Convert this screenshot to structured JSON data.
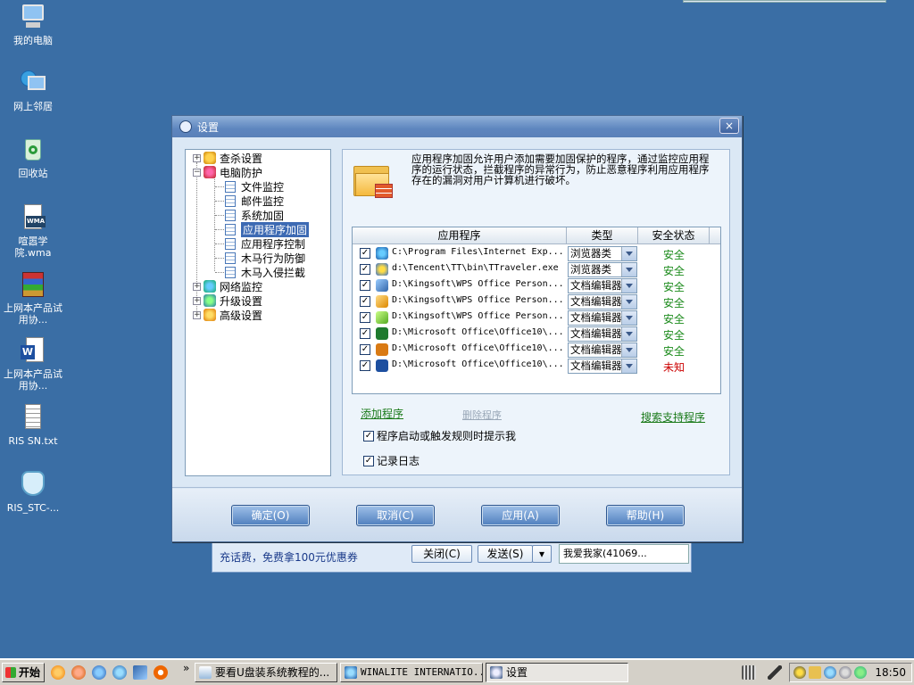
{
  "desktop": {
    "icons": [
      {
        "label": "我的电脑"
      },
      {
        "label": "网上邻居"
      },
      {
        "label": "回收站"
      },
      {
        "label": "喧嚣学院.wma"
      },
      {
        "label": "上网本产品试用协..."
      },
      {
        "label": "上网本产品试用协..."
      },
      {
        "label": "RIS SN.txt"
      },
      {
        "label": "RIS_STC-..."
      }
    ]
  },
  "dialog": {
    "title": "设置",
    "close": "×",
    "tree": [
      {
        "label": "查杀设置",
        "toggle": "+"
      },
      {
        "label": "电脑防护",
        "toggle": "−"
      },
      {
        "label": "文件监控"
      },
      {
        "label": "邮件监控"
      },
      {
        "label": "系统加固"
      },
      {
        "label": "应用程序加固"
      },
      {
        "label": "应用程序控制"
      },
      {
        "label": "木马行为防御"
      },
      {
        "label": "木马入侵拦截"
      },
      {
        "label": "网络监控",
        "toggle": "+"
      },
      {
        "label": "升级设置",
        "toggle": "+"
      },
      {
        "label": "高级设置",
        "toggle": "+"
      }
    ],
    "description": "应用程序加固允许用户添加需要加固保护的程序，通过监控应用程序的运行状态，拦截程序的异常行为，防止恶意程序利用应用程序存在的漏洞对用户计算机进行破坏。",
    "table": {
      "headers": [
        "应用程序",
        "类型",
        "安全状态"
      ],
      "rows": [
        {
          "checked": "✓",
          "path": "C:\\Program Files\\Internet Exp...",
          "type": "浏览器类",
          "status": "安全"
        },
        {
          "checked": "✓",
          "path": "d:\\Tencent\\TT\\bin\\TTraveler.exe",
          "type": "浏览器类",
          "status": "安全"
        },
        {
          "checked": "✓",
          "path": "D:\\Kingsoft\\WPS Office Person...",
          "type": "文档编辑器",
          "status": "安全"
        },
        {
          "checked": "✓",
          "path": "D:\\Kingsoft\\WPS Office Person...",
          "type": "文档编辑器",
          "status": "安全"
        },
        {
          "checked": "✓",
          "path": "D:\\Kingsoft\\WPS Office Person...",
          "type": "文档编辑器",
          "status": "安全"
        },
        {
          "checked": "✓",
          "path": "D:\\Microsoft Office\\Office10\\...",
          "type": "文档编辑器",
          "status": "安全"
        },
        {
          "checked": "✓",
          "path": "D:\\Microsoft Office\\Office10\\...",
          "type": "文档编辑器",
          "status": "安全"
        },
        {
          "checked": "✓",
          "path": "D:\\Microsoft Office\\Office10\\...",
          "type": "文档编辑器",
          "status": "未知"
        }
      ]
    },
    "links": {
      "add": "添加程序",
      "delete": "删除程序",
      "search": "搜索支持程序"
    },
    "options": [
      {
        "checked": "✓",
        "label": "程序启动或触发规则时提示我"
      },
      {
        "checked": "✓",
        "label": "记录日志"
      }
    ],
    "buttons": {
      "ok": "确定(O)",
      "cancel": "取消(C)",
      "apply": "应用(A)",
      "help": "帮助(H)"
    },
    "colors": {
      "safe": "#1a8a1a",
      "unknown": "#cc0000",
      "link": "#1a7a1a"
    }
  },
  "im_window": {
    "promo": "充话费，免费拿100元优惠券",
    "close_btn": "关闭(C)",
    "send_btn": "发送(S)",
    "contact": "我爱我家(41069..."
  },
  "taskbar": {
    "start": "开始",
    "chevron": "»",
    "tasks": [
      {
        "label": "要看U盘装系统教程的..."
      },
      {
        "label": "WINALITE INTERNATIO..."
      },
      {
        "label": "设置"
      }
    ],
    "clock": "18:50"
  }
}
